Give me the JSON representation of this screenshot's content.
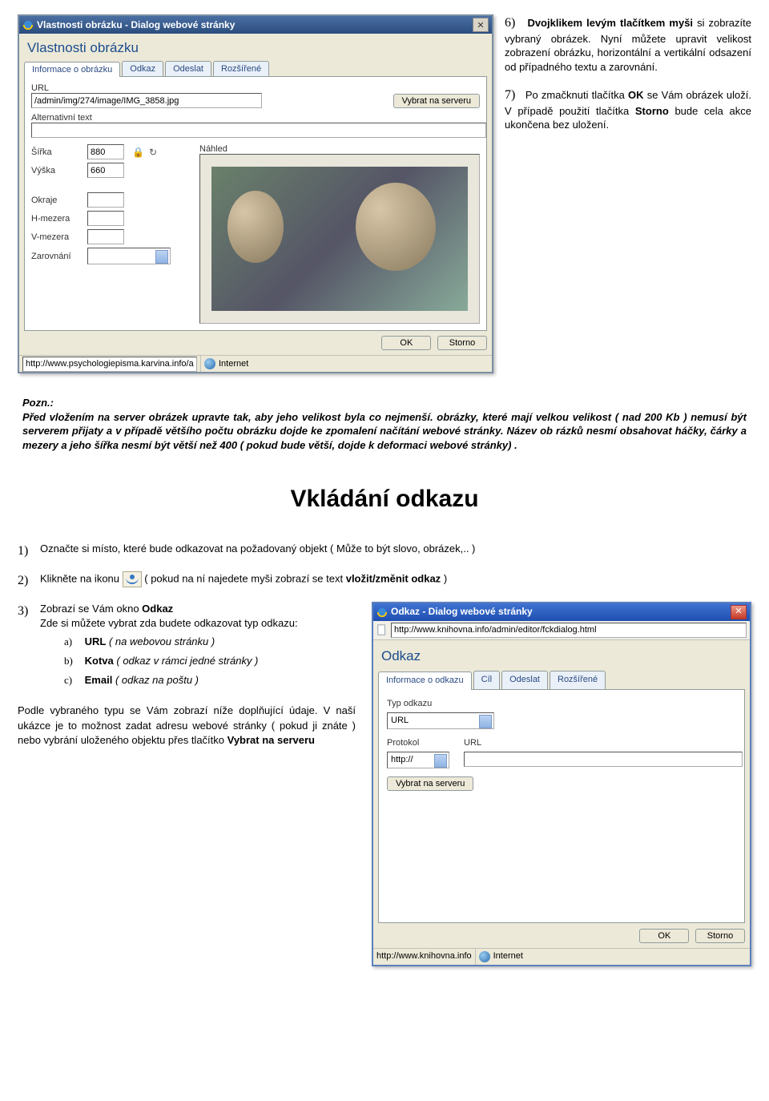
{
  "dialog1": {
    "title": "Vlastnosti obrázku - Dialog webové stránky",
    "heading": "Vlastnosti obrázku",
    "tabs": [
      "Informace o obrázku",
      "Odkaz",
      "Odeslat",
      "Rozšířené"
    ],
    "url_label": "URL",
    "url_value": "/admin/img/274/image/IMG_3858.jpg",
    "server_btn": "Vybrat na serveru",
    "alt_label": "Alternativní text",
    "preview_label": "Náhled",
    "width_label": "Šířka",
    "width_value": "880",
    "height_label": "Výška",
    "height_value": "660",
    "margins_label": "Okraje",
    "hspace_label": "H-mezera",
    "vspace_label": "V-mezera",
    "align_label": "Zarovnání",
    "ok": "OK",
    "cancel": "Storno",
    "status_url": "http://www.psychologiepisma.karvina.info/adi",
    "zone": "Internet"
  },
  "notes": {
    "n6_num": "6)",
    "n6_line1": "Dvojklikem levým tlačítkem myši",
    "n6_rest": "si zobrazíte vybraný obrázek. Nyní můžete upravit velikost zobrazení obrázku, horizontální a vertikální odsazení od případného textu a zarovnání.",
    "n7_num": "7)",
    "n7_pre": "Po zmačknuti tlačítka ",
    "n7_ok": "OK",
    "n7_mid": " se Vám obrázek uloží. V případě použití tlačítka ",
    "n7_storno": "Storno",
    "n7_post": " bude cela akce ukončena bez uložení."
  },
  "pozn": {
    "title": "Pozn.:",
    "text": "Před vložením  na server obrázek upravte tak, aby jeho velikost byla co nejmenší. obrázky, které mají velkou velikost ( nad 200 Kb ) nemusí být serverem přijaty a v případě většího počtu obrázku dojde ke zpomalení načítání webové stránky. Název ob rázků nesmí obsahovat háčky, čárky a mezery a jeho šířka nesmí být větší než 400 ( pokud bude větší, dojde k deformaci webové stránky) ."
  },
  "heading_main": "Vkládání odkazu",
  "list": {
    "m1": "1)",
    "t1": "Označte si místo, které bude odkazovat na požadovaný objekt ( Může to být slovo, obrázek,.. )",
    "m2": "2)",
    "t2a": "Klikněte na ikonu ",
    "t2b": " ( pokud na ní najedete myši zobrazí se text ",
    "t2bold": "vložit/změnit odkaz",
    "t2c": " )",
    "m3": "3)",
    "t3a": "Zobrazí se Vám okno ",
    "t3b": "Odkaz",
    "t3c": "Zde si můžete vybrat zda budete odkazovat typ odkazu:",
    "sa": "a)",
    "sa_b": "URL",
    "sa_i": " ( na webovou stránku )",
    "sb": "b)",
    "sb_b": "Kotva",
    "sb_i": " ( odkaz v rámci jedné stránky )",
    "sc": "c)",
    "sc_b": "Email",
    "sc_i": " ( odkaz na poštu )",
    "after_pre": "Podle vybraného typu se Vám zobrazí níže doplňující údaje. V naší ukázce je to možnost zadat adresu webové stránky ( pokud ji znáte ) nebo vybrání uloženého objektu přes tlačítko ",
    "after_b": "Vybrat na serveru"
  },
  "dialog2": {
    "title": "Odkaz - Dialog webové stránky",
    "addr": "http://www.knihovna.info/admin/editor/fckdialog.html",
    "heading": "Odkaz",
    "tabs": [
      "Informace o odkazu",
      "Cíl",
      "Odeslat",
      "Rozšířené"
    ],
    "type_label": "Typ odkazu",
    "type_value": "URL",
    "protocol_label": "Protokol",
    "protocol_value": "http://",
    "url_label": "URL",
    "server_btn": "Vybrat na serveru",
    "ok": "OK",
    "cancel": "Storno",
    "status_url": "http://www.knihovna.info",
    "zone": "Internet"
  }
}
